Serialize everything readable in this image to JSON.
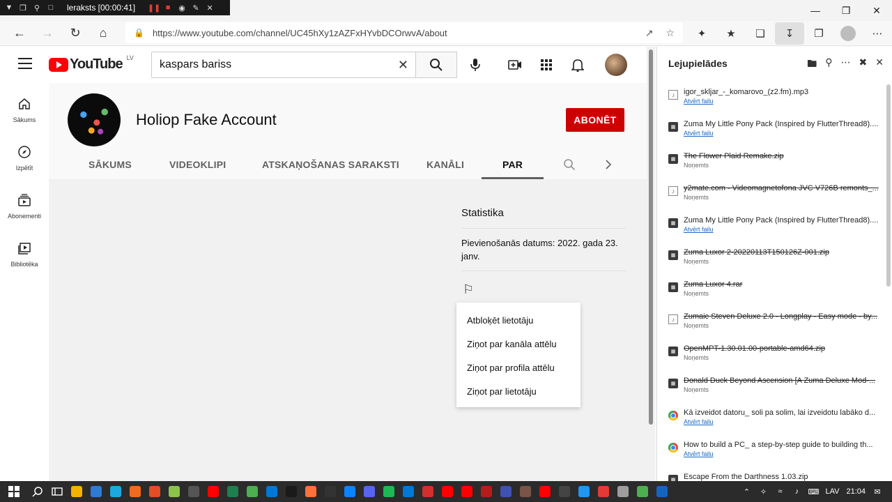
{
  "recorder": {
    "title": "leraksts [00:00:41]"
  },
  "browser": {
    "url": "https://www.youtube.com/channel/UC45hXy1zAZFxHYvbDCOrwvA/about"
  },
  "youtube": {
    "logo_text": "YouTube",
    "country_code": "LV",
    "search_value": "kaspars bariss",
    "guide": [
      {
        "label": "Sākums",
        "icon": "home-icon"
      },
      {
        "label": "Izpētīt",
        "icon": "compass-icon"
      },
      {
        "label": "Abonementi",
        "icon": "subscriptions-icon"
      },
      {
        "label": "Bibliotēka",
        "icon": "library-icon"
      }
    ],
    "channel": {
      "name": "Holiop Fake Account",
      "subscribe_label": "ABONĒT",
      "tabs": [
        "SĀKUMS",
        "VIDEOKLIPI",
        "ATSKAŅOŠANAS SARAKSTI",
        "KANĀLI",
        "PAR"
      ],
      "active_tab": "PAR"
    },
    "about": {
      "stats_title": "Statistika",
      "joined": "Pievienošanās datums: 2022. gada 23. janv.",
      "menu": [
        "Atbloķēt lietotāju",
        "Ziņot par kanāla attēlu",
        "Ziņot par profila attēlu",
        "Ziņot par lietotāju"
      ]
    }
  },
  "downloads": {
    "title": "Lejupielādes",
    "items": [
      {
        "name": "igor_skljar_-_komarovo_(z2.fm).mp3",
        "status": "Atvērt failu",
        "removed": false,
        "icon": "doc"
      },
      {
        "name": "Zuma My Little Pony Pack (Inspired by FlutterThread8)....",
        "status": "Atvērt failu",
        "removed": false,
        "icon": "zip"
      },
      {
        "name": "The Flower Plaid Remake.zip",
        "status": "Noņemts",
        "removed": true,
        "icon": "zip"
      },
      {
        "name": "y2mate.com - Videomagnetofona JVC V726B remonts_...",
        "status": "Noņemts",
        "removed": true,
        "icon": "doc"
      },
      {
        "name": "Zuma My Little Pony Pack (Inspired by FlutterThread8)....",
        "status": "Atvērt failu",
        "removed": false,
        "icon": "zip"
      },
      {
        "name": "Zuma Luxor 2-20220113T150126Z-001.zip",
        "status": "Noņemts",
        "removed": true,
        "icon": "zip"
      },
      {
        "name": "Zuma Luxor 4.rar",
        "status": "Noņemts",
        "removed": true,
        "icon": "zip"
      },
      {
        "name": "Zumaic Steven Deluxe 2.0 - Longplay - Easy mode - by...",
        "status": "Noņemts",
        "removed": true,
        "icon": "doc"
      },
      {
        "name": "OpenMPT-1.30.01.00-portable-amd64.zip",
        "status": "Noņemts",
        "removed": true,
        "icon": "zip"
      },
      {
        "name": "Donald Duck Beyond Ascension [A Zuma Deluxe Mod-...",
        "status": "Noņemts",
        "removed": true,
        "icon": "zip"
      },
      {
        "name": "Kā izveidot datoru_ soli pa solim, lai izveidotu labāko d...",
        "status": "Atvērt failu",
        "removed": false,
        "icon": "chrome"
      },
      {
        "name": "How to build a PC_ a step-by-step guide to building th...",
        "status": "Atvērt failu",
        "removed": false,
        "icon": "chrome"
      },
      {
        "name": "Escape From the Darthness 1.03.zip",
        "status": "",
        "removed": false,
        "icon": "zip"
      }
    ]
  },
  "taskbar": {
    "language": "LAV",
    "time": "21:04",
    "apps": [
      "#f5b301",
      "#2e7bd6",
      "#1ea8e0",
      "#f06b1f",
      "#e44d26",
      "#8bc34a",
      "#555555",
      "#ff0000",
      "#1e7f4f",
      "#4caf50",
      "#0078d7",
      "#1a1a1a",
      "#ff7139",
      "#333333",
      "#0a84ff",
      "#5865f2",
      "#1db954",
      "#0078d7",
      "#d32f2f",
      "#ff0000",
      "#ff0000",
      "#b71c1c",
      "#3f51b5",
      "#795548",
      "#ff0000",
      "#444444",
      "#2196f3",
      "#e53935",
      "#9e9e9e",
      "#4caf50",
      "#1565c0"
    ]
  }
}
